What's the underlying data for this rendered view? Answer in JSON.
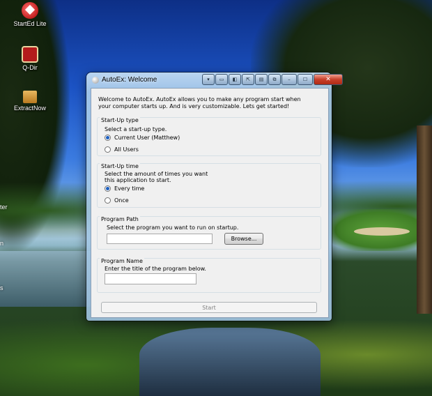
{
  "desktop": {
    "icons": [
      {
        "label": "StartEd Lite",
        "icon": "started-lite-icon"
      },
      {
        "label": "Q-Dir",
        "icon": "q-dir-icon"
      },
      {
        "label": "ExtractNow",
        "icon": "extractnow-icon"
      }
    ],
    "edge_labels": [
      "ter",
      "n",
      "s"
    ]
  },
  "window": {
    "title": "AutoEx: Welcome",
    "titlebar_buttons": [
      "▾",
      "▭",
      "◧",
      "⇱",
      "▤",
      "⧉"
    ],
    "minimize": "–",
    "maximize": "☐",
    "close": "✕"
  },
  "intro_text": "Welcome to AutoEx. AutoEx allows you to make any program start when your computer starts up. And is very customizable. Lets get started!",
  "startup_type": {
    "title": "Start-Up type",
    "prompt": "Select a start-up type.",
    "options": [
      {
        "label": "Current User (Matthew)",
        "selected": true
      },
      {
        "label": "All Users",
        "selected": false
      }
    ]
  },
  "startup_time": {
    "title": "Start-Up time",
    "prompt": "Select the amount of times you want this application to start.",
    "options": [
      {
        "label": "Every time",
        "selected": true
      },
      {
        "label": "Once",
        "selected": false
      }
    ]
  },
  "program_path": {
    "title": "Program Path",
    "prompt": "Select the program you want to run on startup.",
    "value": "",
    "browse_label": "Browse..."
  },
  "program_name": {
    "title": "Program Name",
    "prompt": "Enter the title of the program below.",
    "value": ""
  },
  "start_label": "Start",
  "colors": {
    "accent": "#1c5fc0",
    "client_bg": "#f0f0f0",
    "close_red": "#c8402a"
  }
}
